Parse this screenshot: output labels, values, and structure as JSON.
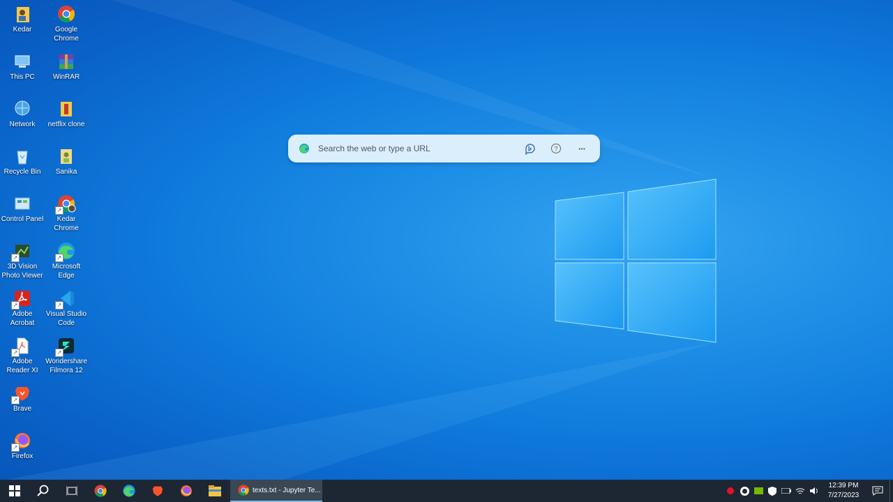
{
  "desktop": {
    "icons": [
      {
        "label": "Kedar"
      },
      {
        "label": "Google Chrome"
      },
      {
        "label": "This PC"
      },
      {
        "label": "WinRAR"
      },
      {
        "label": "Network"
      },
      {
        "label": "netflix clone"
      },
      {
        "label": "Recycle Bin"
      },
      {
        "label": "Sanika"
      },
      {
        "label": "Control Panel"
      },
      {
        "label": "Kedar Chrome"
      },
      {
        "label": "3D Vision Photo Viewer"
      },
      {
        "label": "Microsoft Edge"
      },
      {
        "label": "Adobe Acrobat"
      },
      {
        "label": "Visual Studio Code"
      },
      {
        "label": "Adobe Reader XI"
      },
      {
        "label": "Wondershare Filmora 12"
      },
      {
        "label": "Brave"
      },
      {
        "label": "Firefox"
      }
    ]
  },
  "search": {
    "placeholder": "Search the web or type a URL",
    "bing_icon": "bing-icon",
    "help_icon": "?",
    "more_icon": "···"
  },
  "taskbar": {
    "pinned": [
      "start-icon",
      "search-icon",
      "task-view-icon",
      "chrome-icon",
      "edge-icon",
      "brave-icon",
      "firefox-icon",
      "file-explorer-icon"
    ],
    "active_task": "texts.txt - Jupyter Te...",
    "clock_time": "12:39 PM",
    "clock_date": "7/27/2023"
  },
  "colors": {
    "taskbar": "#1c2733",
    "accent": "#76b9ed"
  }
}
